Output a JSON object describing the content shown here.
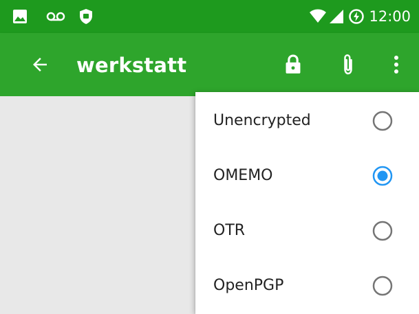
{
  "status_bar": {
    "time": "12:00",
    "left_icons": [
      "image-icon",
      "voicemail-icon",
      "shield-icon"
    ],
    "right_icons": [
      "wifi-icon",
      "cell-signal-icon",
      "battery-saver-icon"
    ],
    "background_color": "#1e9a1e"
  },
  "app_bar": {
    "title": "werkstatt",
    "background_color": "#2ea52c",
    "actions": [
      "lock-icon",
      "attachment-icon",
      "overflow-menu-icon"
    ]
  },
  "encryption_menu": {
    "options": [
      {
        "label": "Unencrypted",
        "selected": false
      },
      {
        "label": "OMEMO",
        "selected": true
      },
      {
        "label": "OTR",
        "selected": false
      },
      {
        "label": "OpenPGP",
        "selected": false
      }
    ],
    "accent_color": "#2196f3",
    "unselected_color": "#757575"
  }
}
